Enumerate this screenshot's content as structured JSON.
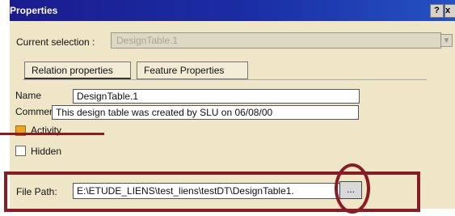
{
  "window": {
    "title": "Properties",
    "help_label": "?",
    "close_label": "x"
  },
  "selection": {
    "label": "Current selection :",
    "value": "DesignTable.1",
    "dropdown_arrow": "chevron-down-icon"
  },
  "tabs": [
    {
      "label": "Relation properties",
      "active": true
    },
    {
      "label": "Feature Properties",
      "active": false
    }
  ],
  "properties": {
    "name_label": "Name",
    "name_value": "DesignTable.1",
    "comment_label": "Comment",
    "comment_value": "This design table was created by SLU on 06/08/00",
    "activity_label": "Activity",
    "activity_checked": true,
    "hidden_label": "Hidden",
    "hidden_checked": false,
    "filepath_label": "File Path:",
    "filepath_value": "E:\\ETUDE_LIENS\\test_liens\\testDT\\DesignTable1.",
    "browse_label": "..."
  },
  "colors": {
    "titlebar": "#1b2ea5",
    "dialog_bg": "#efe6c8",
    "highlight": "#8a1a24",
    "checkbox_on": "#e9a31c"
  }
}
